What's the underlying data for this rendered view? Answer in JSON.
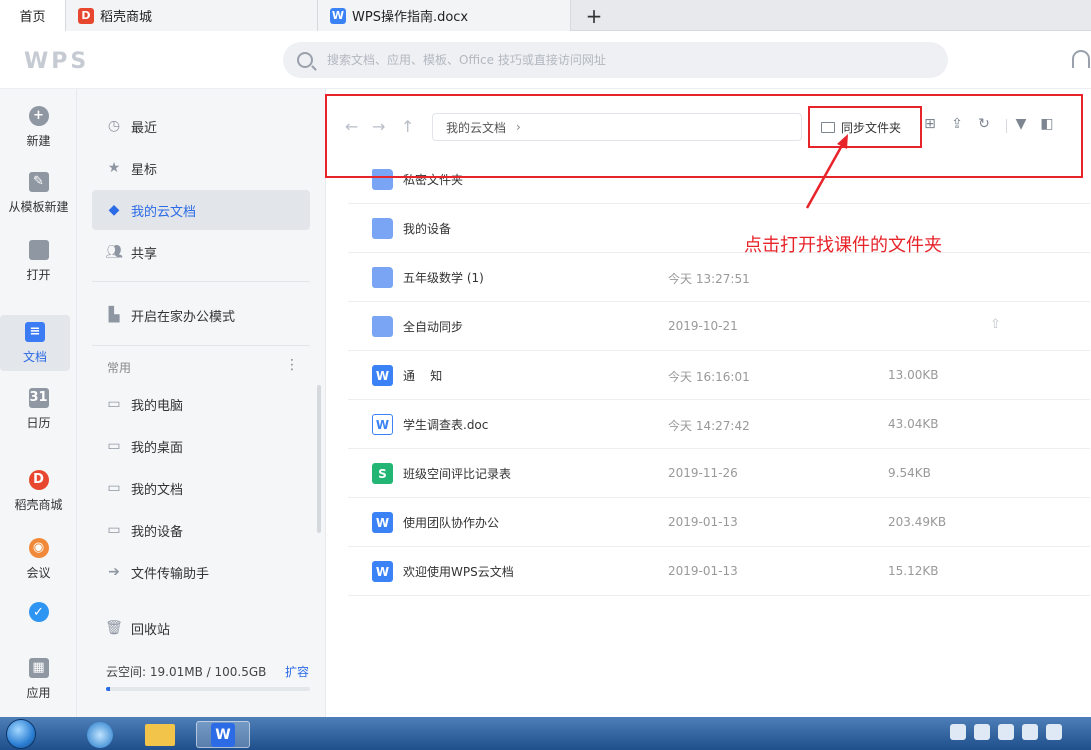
{
  "tabs": {
    "home": "首页",
    "store": "稻壳商城",
    "doc": "WPS操作指南.docx",
    "add": "+"
  },
  "header": {
    "logo": "WPS",
    "search_placeholder": "搜索文档、应用、模板、Office 技巧或直接访问网址"
  },
  "rail": {
    "new": "新建",
    "template": "从模板新建",
    "open": "打开",
    "docs": "文档",
    "calendar": "日历",
    "store": "稻壳商城",
    "meeting": "会议",
    "app": "应用"
  },
  "nav": {
    "recent": "最近",
    "star": "星标",
    "cloud": "我的云文档",
    "share": "共享",
    "home_office": "开启在家办公模式",
    "section_common": "常用",
    "my_pc": "我的电脑",
    "my_desktop": "我的桌面",
    "my_docs": "我的文档",
    "my_devices": "我的设备",
    "transfer": "文件传输助手",
    "trash": "回收站",
    "cloud_space": "云空间: 19.01MB / 100.5GB",
    "expand": "扩容",
    "cloud_used_fraction": 0.02
  },
  "toolbar": {
    "breadcrumb": "我的云文档",
    "sync_folder": "同步文件夹"
  },
  "annotation": "点击打开找课件的文件夹",
  "files": [
    {
      "name": "私密文件夹",
      "time": "",
      "size": "",
      "type": "folder"
    },
    {
      "name": "我的设备",
      "time": "",
      "size": "",
      "type": "folder"
    },
    {
      "name": "五年级数学 (1)",
      "time": "今天 13:27:51",
      "size": "",
      "type": "folder"
    },
    {
      "name": "全自动同步",
      "time": "2019-10-21",
      "size": "",
      "type": "folder"
    },
    {
      "name": "通    知",
      "time": "今天 16:16:01",
      "size": "13.00KB",
      "type": "wdoc"
    },
    {
      "name": "学生调查表.doc",
      "time": "今天 14:27:42",
      "size": "43.04KB",
      "type": "wdoc-outline"
    },
    {
      "name": "班级空间评比记录表",
      "time": "2019-11-26",
      "size": "9.54KB",
      "type": "sheet"
    },
    {
      "name": "使用团队协作办公",
      "time": "2019-01-13",
      "size": "203.49KB",
      "type": "wdoc"
    },
    {
      "name": "欢迎使用WPS云文档",
      "time": "2019-01-13",
      "size": "15.12KB",
      "type": "wdoc"
    }
  ],
  "colors": {
    "accent": "#2b6be6",
    "annotation_red": "#e8242b"
  }
}
